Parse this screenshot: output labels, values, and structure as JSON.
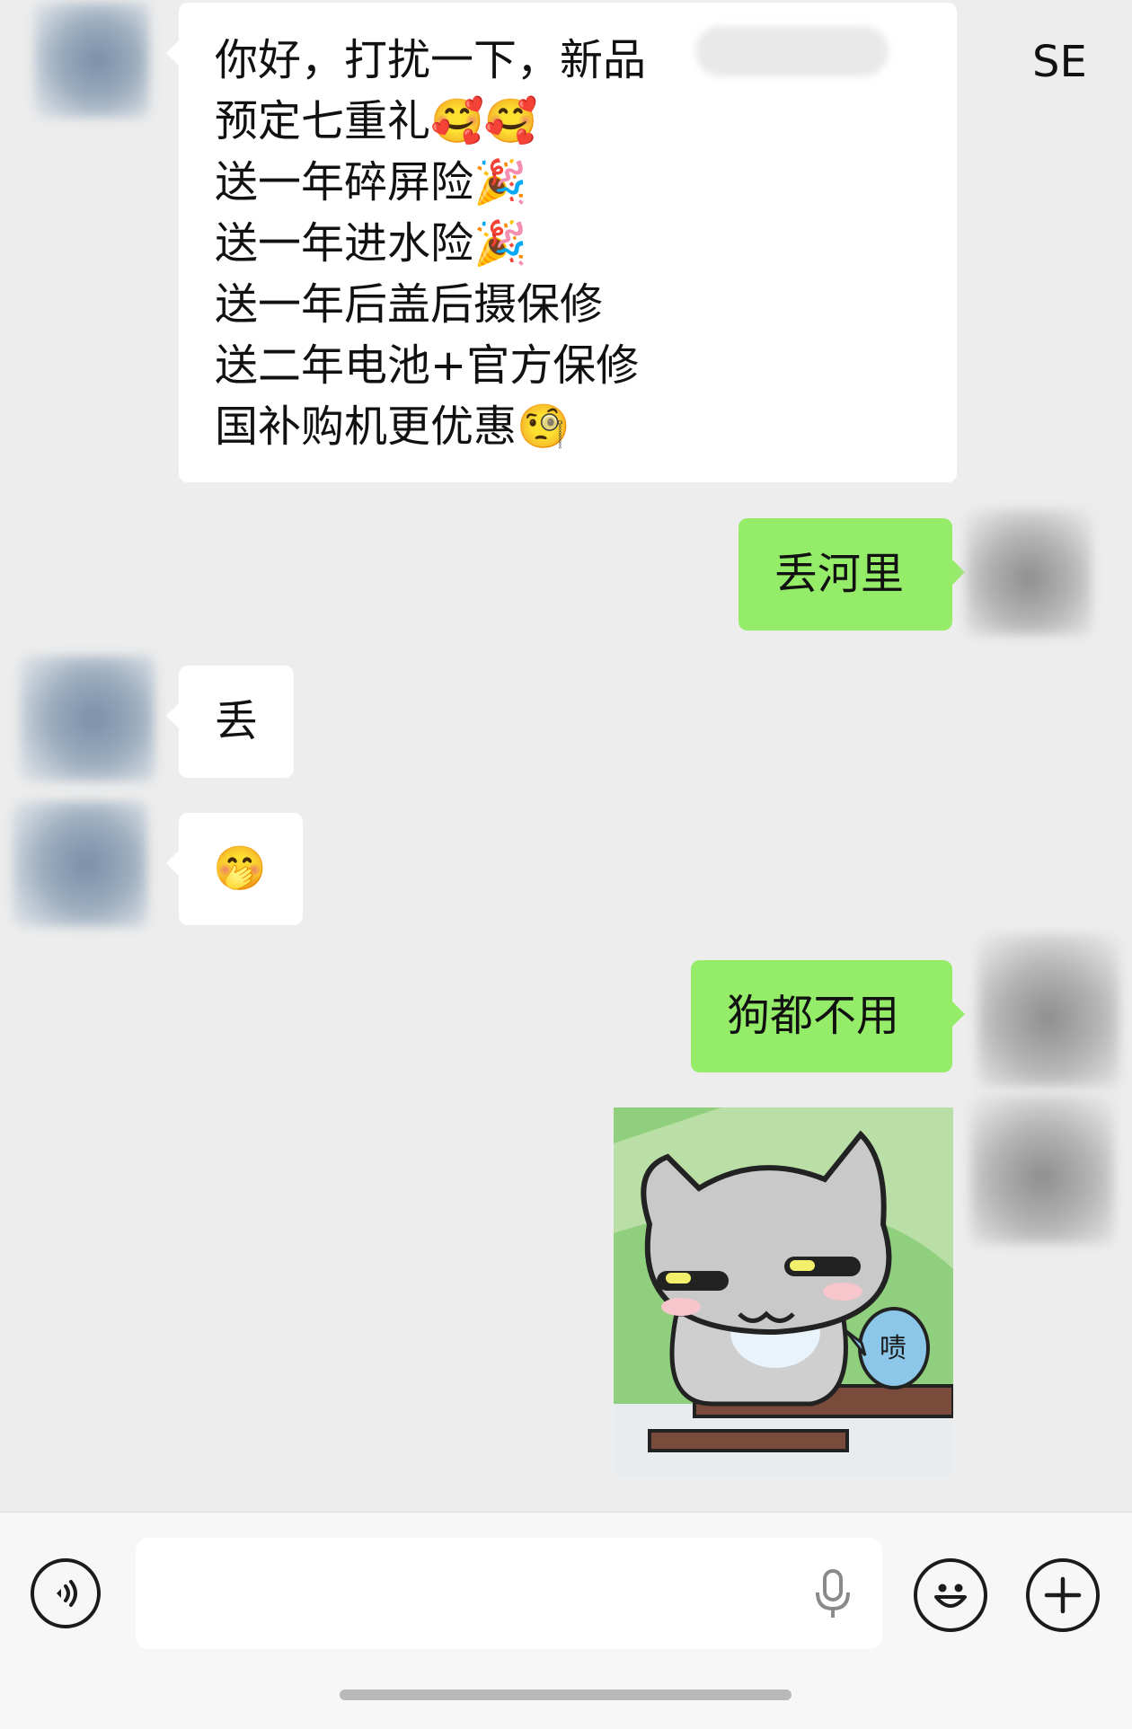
{
  "messages": [
    {
      "side": "in",
      "lines": [
        "你好，打扰一下，新品",
        "预定七重礼🥰🥰",
        "送一年碎屏险🎉",
        "送一年进水险🎉",
        "送一年后盖后摄保修",
        "送二年电池+官方保修",
        "国补购机更优惠🧐"
      ],
      "partial_visible_suffix": "SE"
    },
    {
      "side": "out",
      "text": "丢河里"
    },
    {
      "side": "in",
      "text": "丢"
    },
    {
      "side": "in",
      "text": "🤭"
    },
    {
      "side": "out",
      "text": "狗都不用"
    },
    {
      "side": "out",
      "sticker": {
        "speech_text": "啧",
        "colors": {
          "background": "#8fcf7d",
          "cat": "#c9c9c9"
        }
      }
    }
  ],
  "input_bar": {
    "voice_icon": "voice-wave-icon",
    "mic_icon": "microphone-icon",
    "emoji_icon": "smiley-icon",
    "plus_icon": "plus-icon",
    "input_value": ""
  },
  "colors": {
    "chat_background": "#ededed",
    "incoming_bubble": "#ffffff",
    "outgoing_bubble": "#95ec69",
    "input_bar_background": "#f7f7f7"
  }
}
